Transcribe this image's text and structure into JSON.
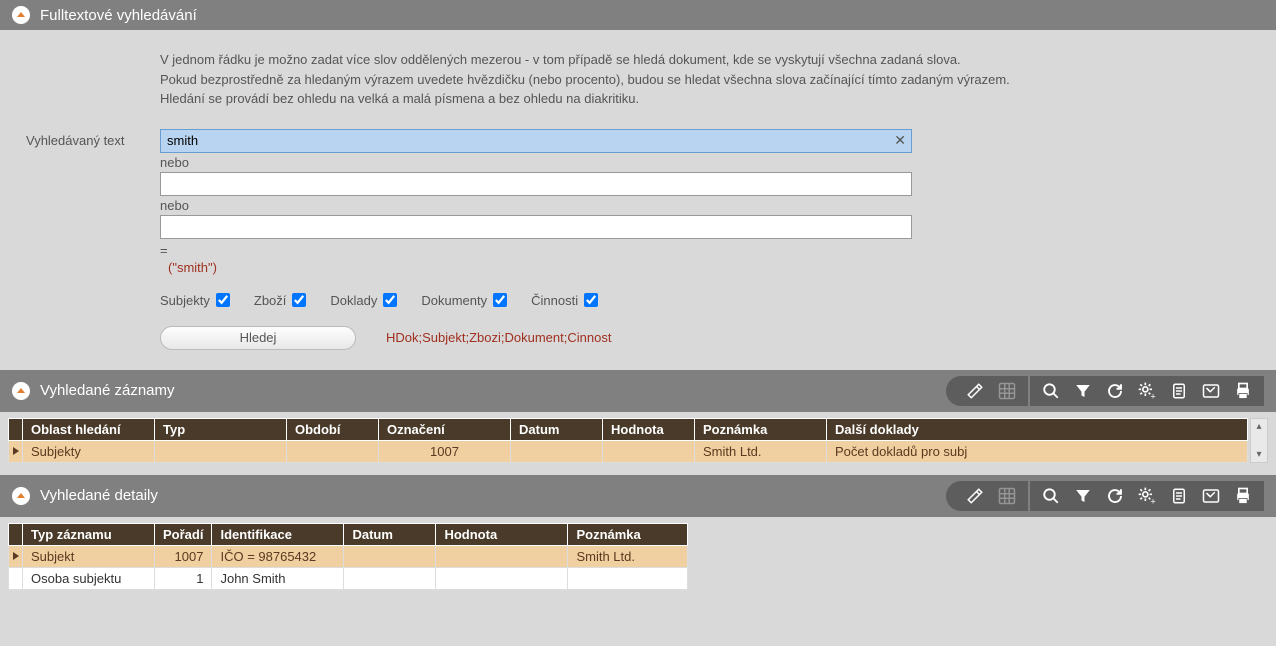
{
  "panels": {
    "search": {
      "title": "Fulltextové vyhledávání"
    },
    "results": {
      "title": "Vyhledané záznamy"
    },
    "details": {
      "title": "Vyhledané detaily"
    }
  },
  "help": {
    "line1": "V jednom řádku je možno zadat více slov oddělených mezerou - v tom případě se hledá dokument, kde se vyskytují všechna zadaná slova.",
    "line2": "Pokud bezprostředně za hledaným výrazem uvedete hvězdičku (nebo procento), budou se hledat všechna slova začínající tímto zadaným výrazem.",
    "line3": "Hledání se provádí bez ohledu na velká a malá písmena a bez ohledu na diakritiku."
  },
  "form": {
    "label_text": "Vyhledávaný text",
    "input1": "smith",
    "or_label": "nebo",
    "input2": "",
    "input3": "",
    "equals": "=",
    "result_expr": "(\"smith\")",
    "checks": {
      "subjekty": "Subjekty",
      "zbozi": "Zboží",
      "doklady": "Doklady",
      "dokumenty": "Dokumenty",
      "cinnosti": "Činnosti"
    },
    "search_btn": "Hledej",
    "sources": "HDok;Subjekt;Zbozi;Dokument;Cinnost"
  },
  "grid1": {
    "headers": [
      "Oblast hledání",
      "Typ",
      "Období",
      "Označení",
      "Datum",
      "Hodnota",
      "Poznámka",
      "Další doklady"
    ],
    "rows": [
      {
        "oblast": "Subjekty",
        "typ": "",
        "obdobi": "",
        "oznaceni": "1007",
        "datum": "",
        "hodnota": "",
        "poznamka": "Smith Ltd.",
        "dalsi": "Počet dokladů pro subj"
      }
    ]
  },
  "grid2": {
    "headers": [
      "Typ záznamu",
      "Pořadí",
      "Identifikace",
      "Datum",
      "Hodnota",
      "Poznámka"
    ],
    "rows": [
      {
        "typ": "Subjekt",
        "poradi": "1007",
        "ident": "IČO = 98765432",
        "datum": "",
        "hodnota": "",
        "poznamka": "Smith Ltd.",
        "sel": true
      },
      {
        "typ": "Osoba subjektu",
        "poradi": "1",
        "ident": "John Smith",
        "datum": "",
        "hodnota": "",
        "poznamka": "",
        "sel": false
      }
    ]
  }
}
